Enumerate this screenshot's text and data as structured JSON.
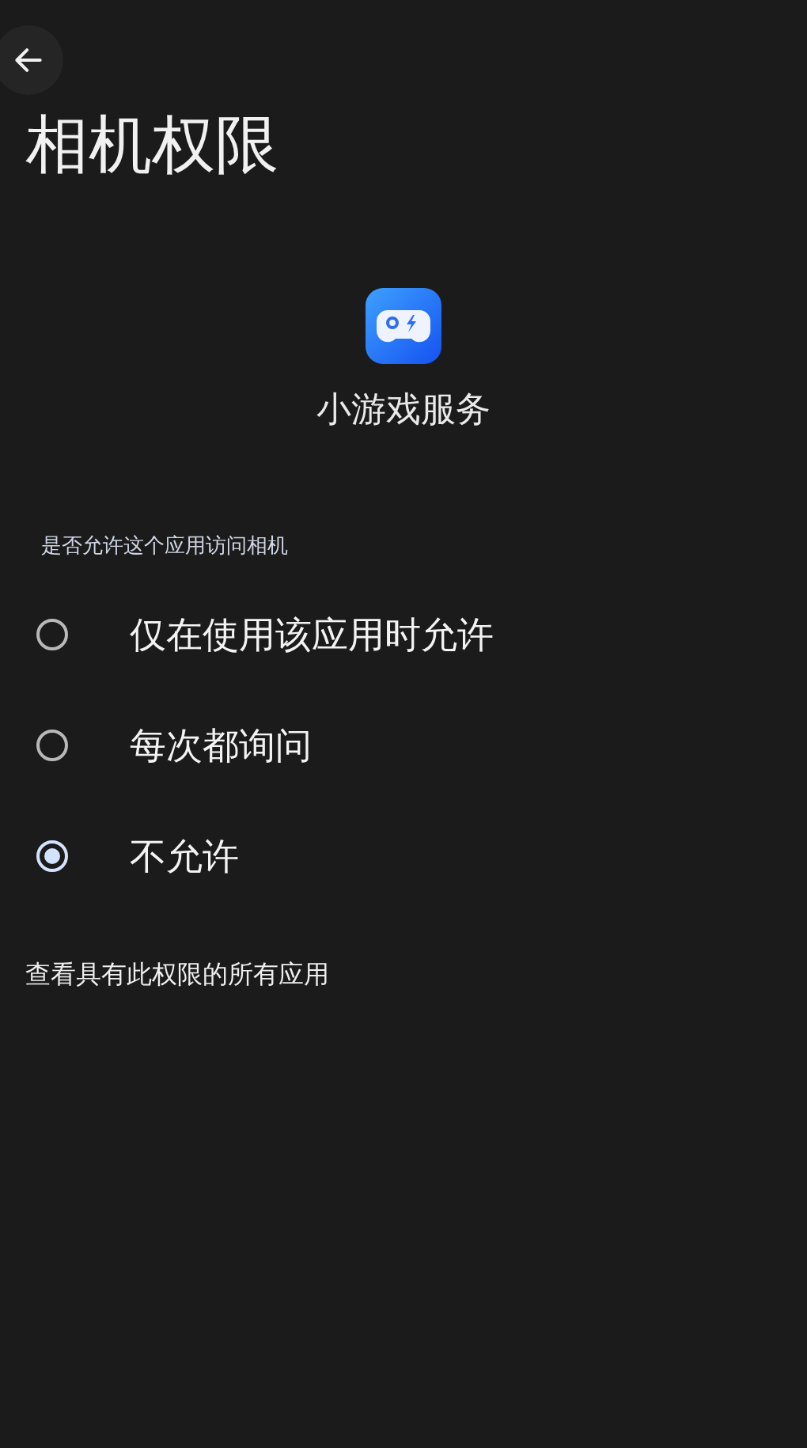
{
  "title": "相机权限",
  "app": {
    "name": "小游戏服务"
  },
  "question": "是否允许这个应用访问相机",
  "options": [
    {
      "label": "仅在使用该应用时允许",
      "selected": false
    },
    {
      "label": "每次都询问",
      "selected": false
    },
    {
      "label": "不允许",
      "selected": true
    }
  ],
  "link": "查看具有此权限的所有应用"
}
